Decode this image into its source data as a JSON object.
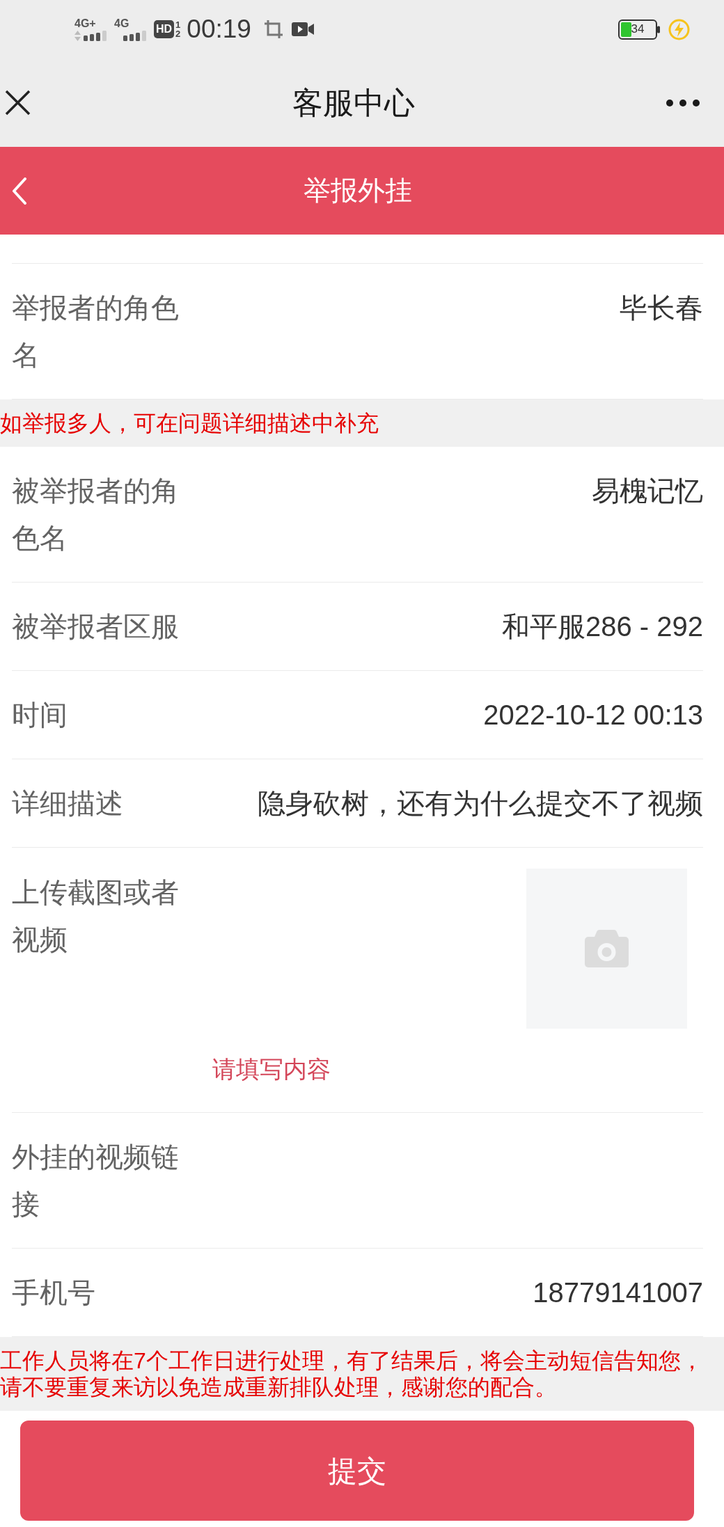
{
  "status_bar": {
    "networks": [
      {
        "label": "4G+",
        "data_activity": true
      },
      {
        "label": "4G",
        "data_activity": false
      }
    ],
    "hd_badge": {
      "label": "HD",
      "digits": [
        "1",
        "2"
      ]
    },
    "time": "00:19",
    "battery_text": "34"
  },
  "nav_bar": {
    "title": "客服中心"
  },
  "header": {
    "title": "举报外挂"
  },
  "form_items": [
    {
      "kind": "field",
      "label": "举报者的角色名",
      "value": "毕长春"
    },
    {
      "kind": "notice",
      "text": "如举报多人，可在问题详细描述中补充"
    },
    {
      "kind": "field",
      "label": "被举报者的角色名",
      "value": "易槐记忆"
    },
    {
      "kind": "field",
      "label": "被举报者区服",
      "value": "和平服286 - 292"
    },
    {
      "kind": "field",
      "label": "时间",
      "value": "2022-10-12 00:13"
    },
    {
      "kind": "field",
      "label": "详细描述",
      "value": "隐身砍树，还有为什么提交不了视频"
    },
    {
      "kind": "upload",
      "label": "上传截图或者视频",
      "error": "请填写内容"
    },
    {
      "kind": "field",
      "label": "外挂的视频链接"
    },
    {
      "kind": "field",
      "label": "手机号",
      "value": "18779141007"
    },
    {
      "kind": "notice",
      "text": "工作人员将在7个工作日进行处理，有了结果后，将会主动短信告知您，请不要重复来访以免造成重新排队处理，感谢您的配合。"
    }
  ],
  "submit_button": {
    "label": "提交"
  }
}
